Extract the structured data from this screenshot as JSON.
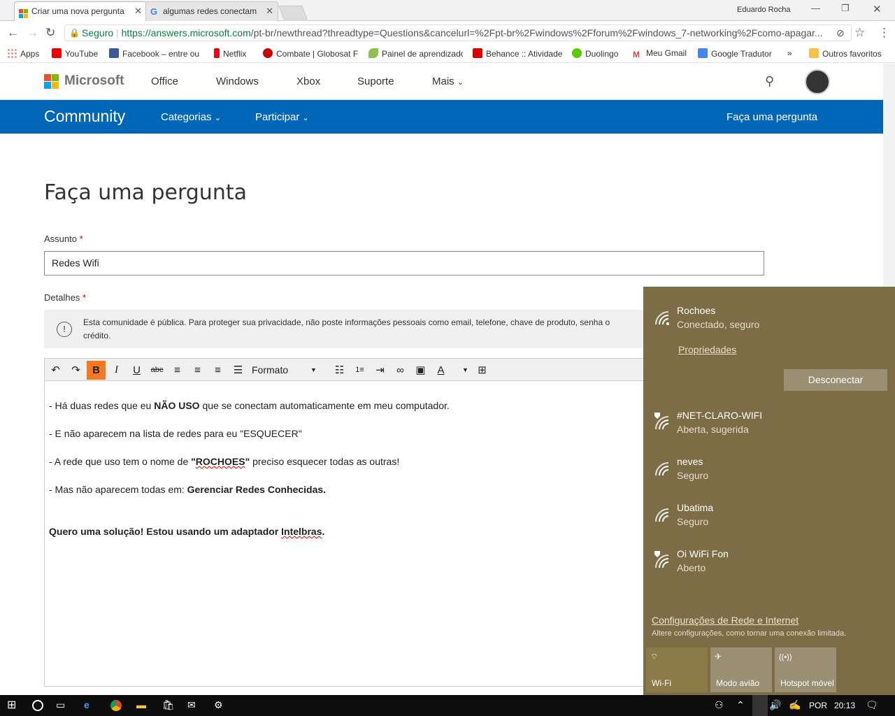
{
  "browser": {
    "tabs": [
      {
        "title": "Criar uma nova pergunta"
      },
      {
        "title": "algumas redes conectam"
      }
    ],
    "user": "Eduardo Rocha",
    "secure_label": "Seguro",
    "url_host": "https://answers.microsoft.com",
    "url_path": "/pt-br/newthread?threadtype=Questions&cancelurl=%2Fpt-br%2Fwindows%2Fforum%2Fwindows_7-networking%2Fcomo-apagar...",
    "bookmarks": [
      "Apps",
      "YouTube",
      "Facebook – entre ou",
      "Netflix",
      "Combate | Globosat F",
      "Painel de aprendizado",
      "Behance :: Atividade",
      "Duolingo",
      "Meu Gmail",
      "Google Tradutor",
      "»",
      "Outros favoritos"
    ]
  },
  "site": {
    "brand": "Microsoft",
    "nav": [
      "Office",
      "Windows",
      "Xbox",
      "Suporte",
      "Mais"
    ],
    "community": "Community",
    "community_nav": [
      "Categorias",
      "Participar"
    ],
    "ask": "Faça uma pergunta"
  },
  "page": {
    "title": "Faça uma pergunta",
    "subject_label": "Assunto",
    "subject_value": "Redes Wifi",
    "details_label": "Detalhes",
    "required": "*",
    "notice_line1": "Esta comunidade é pública. Para proteger sua privacidade, não poste informações pessoais como email, telefone, chave de produto, senha o",
    "notice_line2": "crédito.",
    "format_label": "Formato"
  },
  "editor": {
    "l1a": "- Há duas redes que eu ",
    "l1b": "NÃO USO",
    "l1c": " que se conectam automaticamente em meu computador.",
    "l2": "- E não aparecem na lista de redes para eu \"ESQUECER\"",
    "l3a": "- A rede que uso tem o nome de ",
    "l3b": "\"",
    "l3c": "ROCHOES",
    "l3d": "\"",
    "l3e": " preciso esquecer todas as outras!",
    "l4a": "- Mas não aparecem todas em: ",
    "l4b": "Gerenciar Redes Conhecidas.",
    "l5a": "Quero uma solução! Estou usando um adaptador ",
    "l5b": "Intelbras",
    "l5c": "."
  },
  "flyout": {
    "connected": {
      "name": "Rochoes",
      "status": "Conectado, seguro"
    },
    "properties": "Propriedades",
    "disconnect": "Desconectar",
    "networks": [
      {
        "name": "#NET-CLARO-WIFI",
        "status": "Aberta, sugerida"
      },
      {
        "name": "neves",
        "status": "Seguro"
      },
      {
        "name": "Ubatima",
        "status": "Seguro"
      },
      {
        "name": "Oi WiFi Fon",
        "status": "Aberto"
      }
    ],
    "settings_link": "Configurações de Rede e Internet",
    "settings_desc": "Altere configurações, como tornar uma conexão limitada.",
    "quick": [
      "Wi-Fi",
      "Modo avião",
      "Hotspot móvel"
    ],
    "accent": "#7c6d46"
  },
  "taskbar": {
    "lang": "POR",
    "time": "20:13"
  }
}
